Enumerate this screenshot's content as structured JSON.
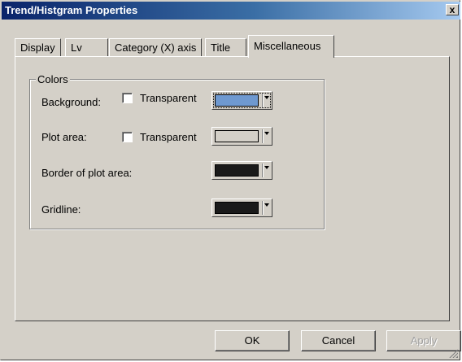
{
  "window": {
    "title": "Trend/Histgram Properties",
    "close_label": "x"
  },
  "tabs": [
    {
      "label": "Display"
    },
    {
      "label": "Lv"
    },
    {
      "label": "Category (X) axis"
    },
    {
      "label": "Title"
    },
    {
      "label": "Miscellaneous",
      "active": true
    }
  ],
  "colors_group": {
    "label": "Colors",
    "background": {
      "label": "Background:",
      "transparent_label": "Transparent",
      "transparent_checked": false,
      "color": "#6f99d0"
    },
    "plot_area": {
      "label": "Plot area:",
      "transparent_label": "Transparent",
      "transparent_checked": false,
      "color": "#d4d0c8"
    },
    "border_plot_area": {
      "label": "Border of plot area:",
      "color": "#1a1a1a"
    },
    "gridline": {
      "label": "Gridline:",
      "color": "#1a1a1a"
    }
  },
  "buttons": {
    "ok": "OK",
    "cancel": "Cancel",
    "apply": "Apply"
  }
}
